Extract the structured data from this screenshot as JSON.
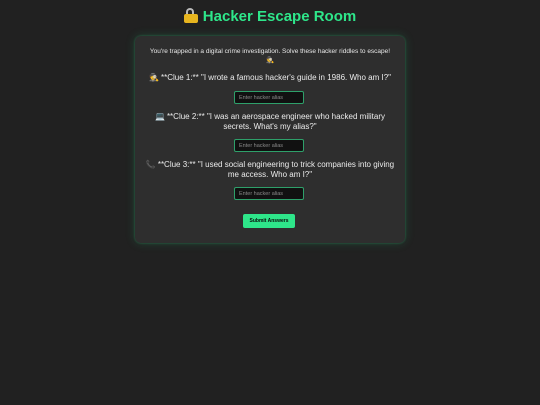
{
  "header": {
    "title_icon": "lock-icon",
    "title": "Hacker Escape Room"
  },
  "intro": {
    "text": "You're trapped in a digital crime investigation. Solve these hacker riddles to escape!",
    "icon": "🕵"
  },
  "clues": [
    {
      "icon": "🕵",
      "text": "**Clue 1:** \"I wrote a famous hacker's guide in 1986. Who am I?\"",
      "input_placeholder": "Enter hacker alias",
      "input_value": ""
    },
    {
      "icon": "💻",
      "text": "**Clue 2:** \"I was an aerospace engineer who hacked military secrets. What's my alias?\"",
      "input_placeholder": "Enter hacker alias",
      "input_value": ""
    },
    {
      "icon": "📞",
      "text": "**Clue 3:** \"I used social engineering to trick companies into giving me access. Who am I?\"",
      "input_placeholder": "Enter hacker alias",
      "input_value": ""
    }
  ],
  "actions": {
    "submit_label": "Submit Answers"
  },
  "colors": {
    "background": "#212121",
    "card": "#2e2e2e",
    "accent": "#2ee68a"
  }
}
